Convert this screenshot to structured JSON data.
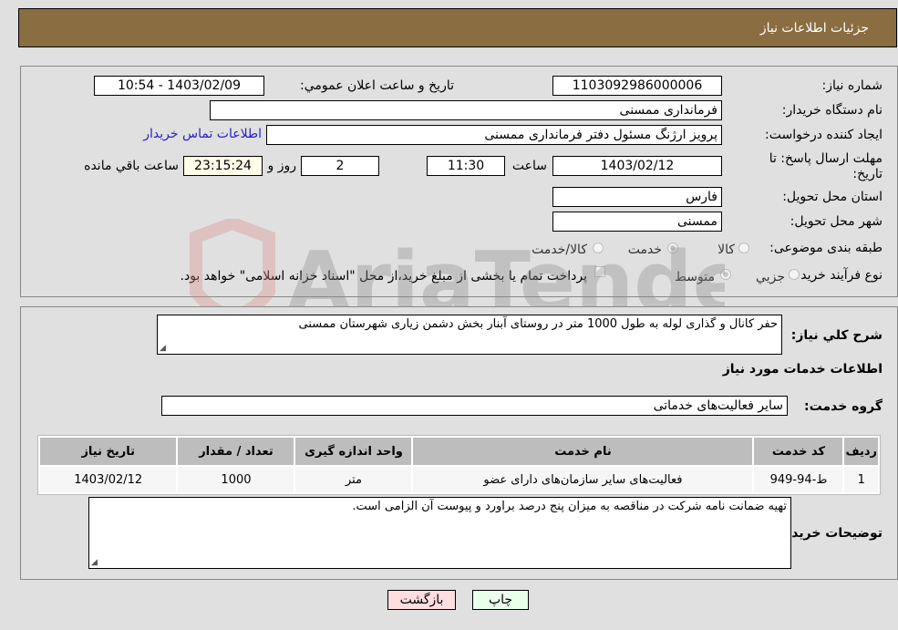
{
  "header": {
    "title": "جزئيات اطلاعات نياز"
  },
  "details": {
    "need_number_label": "شماره نياز:",
    "need_number": "1103092986000006",
    "announce_label": "تاريخ و ساعت اعلان عمومي:",
    "announce_value": "1403/02/09 - 10:54",
    "buyer_name_label": "نام دستگاه خريدار:",
    "buyer_name": "فرمانداری ممسنی",
    "creator_label": "ايجاد کننده درخواست:",
    "creator": "پرويز ارژنگ مسئول دفتر فرمانداری ممسنی",
    "contact_link": "اطلاعات تماس خريدار",
    "deadline_label": "مهلت ارسال پاسخ: تا تاريخ:",
    "deadline_date": "1403/02/12",
    "time_label": "ساعت",
    "deadline_time": "11:30",
    "days": "2",
    "days_label": "روز و",
    "remaining": "23:15:24",
    "remaining_label": "ساعت باقي مانده",
    "province_label": "استان محل تحويل:",
    "province": "فارس",
    "city_label": "شهر محل تحويل:",
    "city": "ممسنی",
    "category_label": "طبقه بندی موضوعی:",
    "category_options": [
      {
        "label": "کالا",
        "selected": false
      },
      {
        "label": "خدمت",
        "selected": true
      },
      {
        "label": "کالا/خدمت",
        "selected": false
      }
    ],
    "process_label": "نوع فرآيند خريد :",
    "process_options": [
      {
        "label": "جزيي",
        "selected": false
      },
      {
        "label": "متوسط",
        "selected": true
      }
    ],
    "treasury_note": "پرداخت تمام يا بخشی از مبلغ خريد،از محل \"اسناد خزانه اسلامی\" خواهد بود.",
    "treasury_checked": false
  },
  "summary": {
    "label": "شرح کلي نياز:",
    "value": "حفر کانال و گذاری لوله به طول 1000 متر در روستای آبنار بخش دشمن زياری شهرستان ممسنی"
  },
  "services": {
    "title": "اطلاعات خدمات مورد نياز",
    "group_label": "گروه خدمت:",
    "group_value": "ساير فعاليت‌های خدماتی",
    "columns": [
      "رديف",
      "کد خدمت",
      "نام خدمت",
      "واحد اندازه گيری",
      "تعداد / مقدار",
      "تاريخ نياز"
    ],
    "rows": [
      [
        "1",
        "ط-94-949",
        "فعاليت‌های ساير سازمان‌های دارای عضو",
        "متر",
        "1000",
        "1403/02/12"
      ]
    ]
  },
  "buyer_notes": {
    "label": "توضيحات خريدار:",
    "value": "تهيه ضمانت نامه شرکت در مناقصه به ميزان پنج درصد براورد و پيوست آن الزامی است."
  },
  "buttons": {
    "print": "چاپ",
    "back": "بازگشت"
  },
  "colors": {
    "header_bg": "#8b6d42",
    "print_bg": "#eaffea",
    "back_bg": "#ffdede",
    "link": "#2222cc"
  }
}
